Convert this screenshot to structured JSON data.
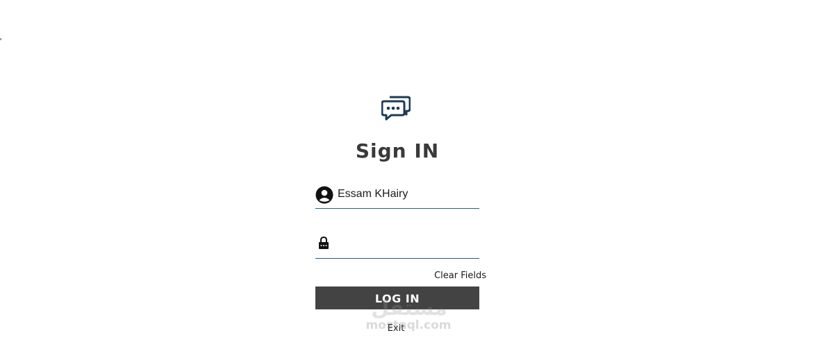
{
  "header": {
    "logo_icon": "chat-bubbles-icon",
    "title": "Sign IN"
  },
  "form": {
    "username": {
      "icon": "user-avatar-icon",
      "value": "Essam KHairy",
      "placeholder": ""
    },
    "password": {
      "icon": "padlock-icon",
      "value": "",
      "placeholder": ""
    },
    "clear_label": "Clear Fields",
    "login_label": "LOG IN",
    "exit_label": "Exit"
  },
  "watermark": {
    "text_arabic": "مستقل",
    "text_latin": "mostaql.com"
  },
  "colors": {
    "title": "#3a3a3a",
    "field_underline": "#1f5f85",
    "login_button_bg": "#434343",
    "login_button_text": "#ffffff",
    "logo": "#1f3a55"
  }
}
